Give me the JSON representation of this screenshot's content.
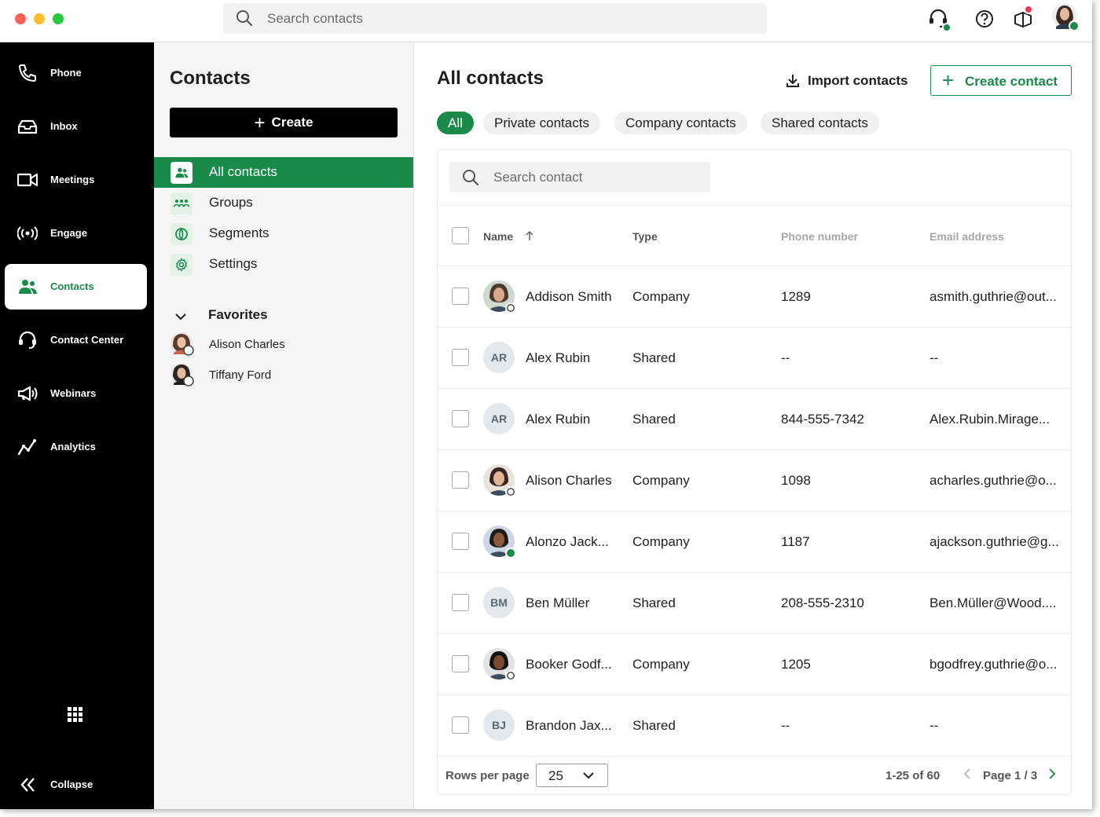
{
  "topbar": {
    "search_placeholder": "Search contacts",
    "icons": [
      "headset-icon",
      "help-icon",
      "whats-new-icon",
      "user-avatar"
    ],
    "status_color": "#1a8a4a",
    "notify_color": "#e8384f"
  },
  "nav": {
    "items": [
      {
        "label": "Phone",
        "icon": "phone-icon",
        "active": false
      },
      {
        "label": "Inbox",
        "icon": "inbox-icon",
        "active": false
      },
      {
        "label": "Meetings",
        "icon": "video-icon",
        "active": false
      },
      {
        "label": "Engage",
        "icon": "broadcast-icon",
        "active": false
      },
      {
        "label": "Contacts",
        "icon": "contacts-icon",
        "active": true
      },
      {
        "label": "Contact Center",
        "icon": "headset-icon",
        "active": false
      },
      {
        "label": "Webinars",
        "icon": "megaphone-icon",
        "active": false
      },
      {
        "label": "Analytics",
        "icon": "chart-icon",
        "active": false
      }
    ],
    "collapse_label": "Collapse"
  },
  "sidebar": {
    "title": "Contacts",
    "create_label": "Create",
    "items": [
      {
        "label": "All contacts",
        "icon": "contacts-icon",
        "active": true
      },
      {
        "label": "Groups",
        "icon": "groups-icon",
        "active": false
      },
      {
        "label": "Segments",
        "icon": "segments-icon",
        "active": false
      },
      {
        "label": "Settings",
        "icon": "gear-icon",
        "active": false
      }
    ],
    "favorites_label": "Favorites",
    "favorites": [
      {
        "name": "Alison Charles"
      },
      {
        "name": "Tiffany Ford"
      }
    ]
  },
  "main": {
    "title": "All contacts",
    "import_label": "Import contacts",
    "create_label": "Create contact",
    "filters": [
      "All",
      "Private contacts",
      "Company contacts",
      "Shared contacts"
    ],
    "active_filter": "All",
    "search_placeholder": "Search contact",
    "columns": {
      "name": "Name",
      "type": "Type",
      "phone": "Phone number",
      "email": "Email address"
    },
    "rows": [
      {
        "initials": "",
        "name": "Addison Smith",
        "type": "Company",
        "phone": "1289",
        "email": "asmith.guthrie@out...",
        "photo": true,
        "online": false
      },
      {
        "initials": "AR",
        "name": "Alex Rubin",
        "type": "Shared",
        "phone": "--",
        "email": "--",
        "photo": false,
        "online": false
      },
      {
        "initials": "AR",
        "name": "Alex Rubin",
        "type": "Shared",
        "phone": "844-555-7342",
        "email": "Alex.Rubin.Mirage...",
        "photo": false,
        "online": false
      },
      {
        "initials": "",
        "name": "Alison Charles",
        "type": "Company",
        "phone": "1098",
        "email": "acharles.guthrie@o...",
        "photo": true,
        "online": false
      },
      {
        "initials": "",
        "name": "Alonzo Jack...",
        "type": "Company",
        "phone": "1187",
        "email": "ajackson.guthrie@g...",
        "photo": true,
        "online": true
      },
      {
        "initials": "BM",
        "name": "Ben Müller",
        "type": "Shared",
        "phone": "208-555-2310",
        "email": "Ben.Müller@Wood....",
        "photo": false,
        "online": false
      },
      {
        "initials": "",
        "name": "Booker Godf...",
        "type": "Company",
        "phone": "1205",
        "email": "bgodfrey.guthrie@o...",
        "photo": true,
        "online": false
      },
      {
        "initials": "BJ",
        "name": "Brandon Jax...",
        "type": "Shared",
        "phone": "--",
        "email": "--",
        "photo": false,
        "online": false
      }
    ],
    "pager": {
      "rows_per_page_label": "Rows per page",
      "rows_per_page": "25",
      "count": "1-25 of 60",
      "page": "Page 1 / 3"
    }
  },
  "colors": {
    "accent": "#1a8a4a",
    "nav_bg": "#000000"
  }
}
